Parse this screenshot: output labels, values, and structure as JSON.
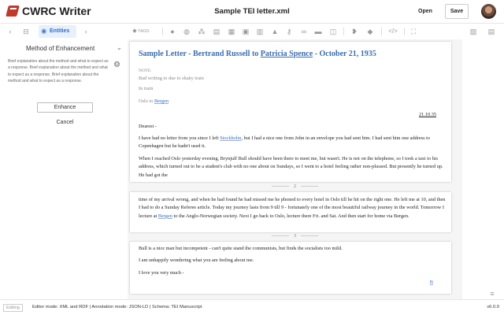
{
  "app": {
    "name": "CWRC Writer",
    "document_title": "Sample TEI letter.xml",
    "open_label": "Open",
    "save_label": "Save"
  },
  "toolbar": {
    "entities_label": "Entities",
    "tags_label": "TAGS"
  },
  "sidebar": {
    "title": "Method of Enhancement",
    "description": "Brief explanation about the method and what to expect as a response. Brief explanation about the method and what to expect as a response. Brief explanation about the method and what to expect as a response.",
    "enhance_label": "Enhance",
    "cancel_label": "Cancel"
  },
  "document": {
    "title_prefix": "Sample Letter - Bertrand Russell to ",
    "title_recipient": "Patricia Spence",
    "title_suffix": " - October 21, 1935",
    "note_label": "NOTE:",
    "note_text": "Bad writing to due to shaky train",
    "in_train": "In train",
    "oslo_prefix": "Oslo to ",
    "oslo_place": "Bergen",
    "date": "21.10.35",
    "salutation": "Dearest -",
    "p1_a": "I have had no letter from you since I left ",
    "p1_place": "Stockholm",
    "p1_b": ", but I had a nice one from John in an envelope you had sent him. I had sent him one address to Copenhagen but he hadn't used it.",
    "p2": "When I reached Oslo yesterday evening, Brynjulf Bull should have been there to meet me, but wasn't. He is not on the telephone, so I took a taxi to his address, which turned out to be a student's club with no one about on Sundays, so I went to a hotel feeling rather non-plussed. But presently he turned up. He had got the",
    "page2_number": "2",
    "p3_a": "time of my arrival wrong, and when he had found he had missed me he phoned to every hotel in Oslo till he hit on the right one. He left me at 10, and then I had to do a Sunday Referee article. Today my journey lasts from 9 till 9 - fortunately one of the most beautiful railway journey in the world. Tomorrow I lecture at ",
    "p3_place": "Bergen",
    "p3_b": " to the Anglo-Norwegian society. Next I go back to Oslo, lecture there Fri. and Sat. And then start for home via Bergen.",
    "page3_number": "3",
    "p4": "Bull is a nice man but incompetent - can't quite stand the communists, but finds the socialists too mild.",
    "p5": "I am unhappily wondering what you are feeling about me.",
    "p6": "I love you very much -",
    "signature": "B"
  },
  "status": {
    "editing_label": "Editing",
    "text": "Editor mode: XML and RDF  |  Annotation mode: JSON-LD  |  Schema: TEI Manuscript",
    "version": "v6.0.0"
  },
  "colors": {
    "accent": "#2a6fd0",
    "title": "#3a6eb0",
    "logo": "#c0392b"
  }
}
